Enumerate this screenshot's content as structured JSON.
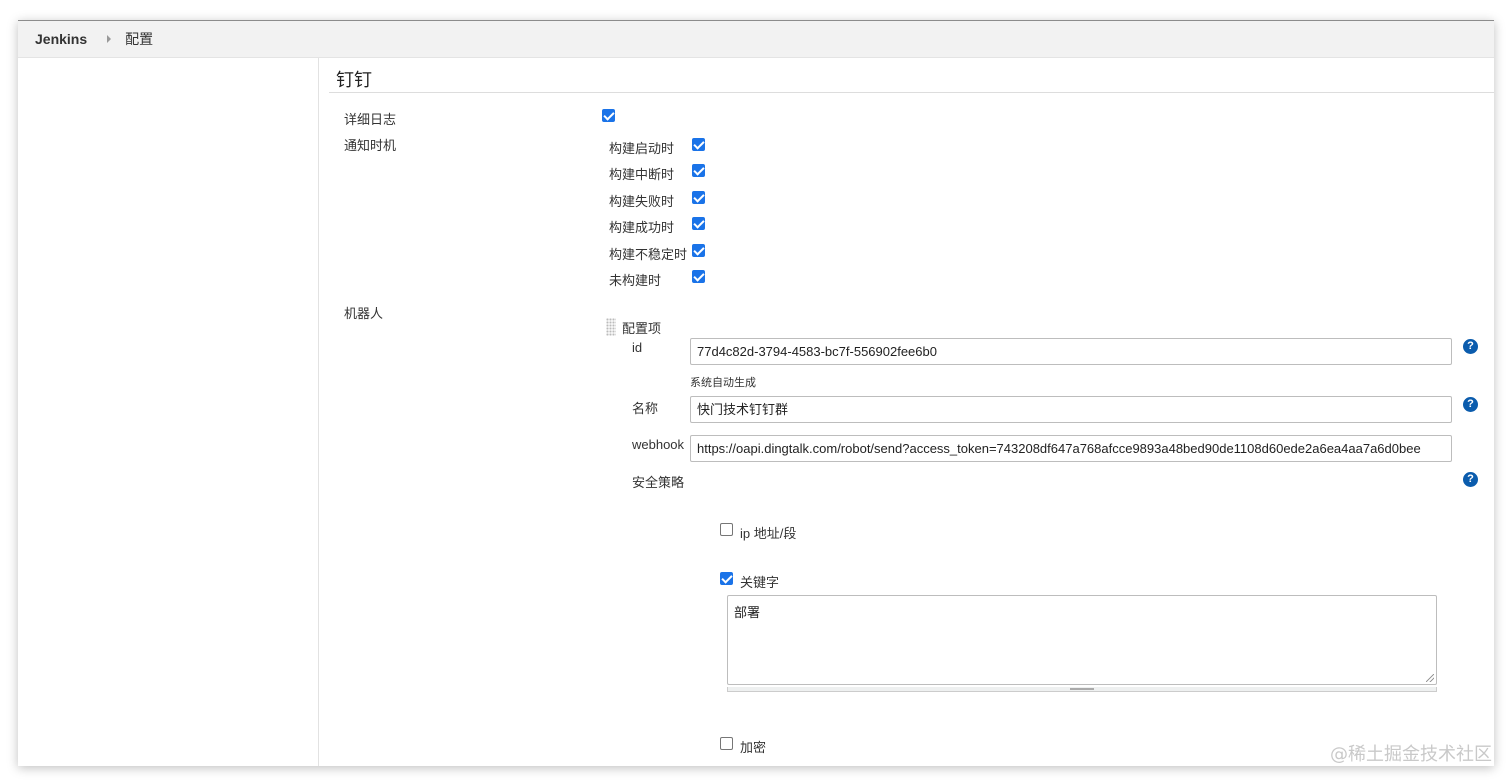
{
  "breadcrumb": {
    "root": "Jenkins",
    "current": "配置"
  },
  "section": {
    "title": "钉钉"
  },
  "verbose_log": {
    "label": "详细日志",
    "checked": true
  },
  "notify": {
    "label": "通知时机",
    "options": [
      {
        "label": "构建启动时",
        "checked": true
      },
      {
        "label": "构建中断时",
        "checked": true
      },
      {
        "label": "构建失败时",
        "checked": true
      },
      {
        "label": "构建成功时",
        "checked": true
      },
      {
        "label": "构建不稳定时",
        "checked": true
      },
      {
        "label": "未构建时",
        "checked": true
      }
    ]
  },
  "robot": {
    "label": "机器人",
    "item_label": "配置项",
    "id_label": "id",
    "id_value": "77d4c82d-3794-4583-bc7f-556902fee6b0",
    "id_hint": "系统自动生成",
    "name_label": "名称",
    "name_value": "快门技术钉钉群",
    "webhook_label": "webhook",
    "webhook_value": "https://oapi.dingtalk.com/robot/send?access_token=743208df647a768afcce9893a48bed90de1108d60ede2a6ea4aa7a6d0bee",
    "security_label": "安全策略",
    "ip_label": "ip 地址/段",
    "ip_checked": false,
    "keyword_label": "关键字",
    "keyword_checked": true,
    "keyword_value": "部署",
    "encrypt_label": "加密",
    "encrypt_checked": false,
    "help_glyph": "?"
  },
  "watermark": "@稀土掘金技术社区",
  "colors": {
    "checkbox": "#1a73e8",
    "help": "#0b5cad"
  }
}
